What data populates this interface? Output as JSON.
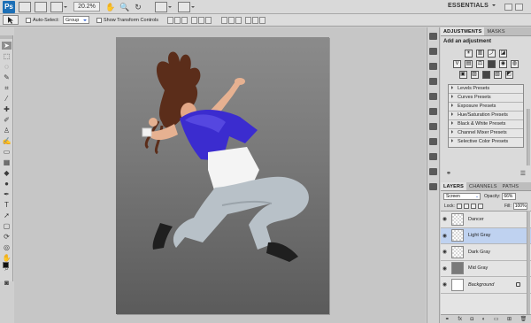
{
  "appbar": {
    "logo": "Ps",
    "zoom": "20.2%",
    "workspace": "ESSENTIALS"
  },
  "options": {
    "auto_select_label": "Auto-Select:",
    "auto_select_value": "Group",
    "show_transform_label": "Show Transform Controls"
  },
  "adjustments": {
    "tabs": [
      "ADJUSTMENTS",
      "MASKS"
    ],
    "title": "Add an adjustment",
    "presets": [
      "Levels Presets",
      "Curves Presets",
      "Exposure Presets",
      "Hue/Saturation Presets",
      "Black & White Presets",
      "Channel Mixer Presets",
      "Selective Color Presets"
    ]
  },
  "layers_panel": {
    "tabs": [
      "LAYERS",
      "CHANNELS",
      "PATHS"
    ],
    "blend_mode": "Screen",
    "opacity_label": "Opacity:",
    "opacity_value": "66%",
    "lock_label": "Lock:",
    "fill_label": "Fill:",
    "fill_value": "100%",
    "layers": [
      {
        "name": "Dancer"
      },
      {
        "name": "Light Gray"
      },
      {
        "name": "Dark Gray"
      },
      {
        "name": "Mid Gray"
      },
      {
        "name": "Background"
      }
    ]
  },
  "colors": {
    "accent": "#2d5fd0",
    "shirt": "#3b2ccf",
    "selection": "#bfd2f0"
  },
  "icons": {
    "move_tool": "move-icon",
    "eye": "eye-icon",
    "lock": "lock-icon"
  }
}
